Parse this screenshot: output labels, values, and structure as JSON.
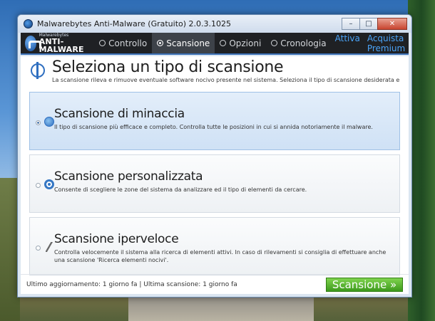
{
  "window": {
    "title": "Malwarebytes Anti-Malware (Gratuito) 2.0.3.1025",
    "minimize": "–",
    "maximize": "□",
    "close": "✕"
  },
  "brand": {
    "top": "Malwarebytes",
    "bottom": "ANTI-MALWARE"
  },
  "nav": {
    "tabs": [
      {
        "label": "Controllo",
        "icon": "clock-icon"
      },
      {
        "label": "Scansione",
        "icon": "scan-icon",
        "active": true
      },
      {
        "label": "Opzioni",
        "icon": "gear-icon"
      },
      {
        "label": "Cronologia",
        "icon": "history-icon"
      }
    ],
    "links": [
      "Attiva",
      "Acquista Premium"
    ]
  },
  "header": {
    "title": "Seleziona un tipo di scansione",
    "subtitle": "La scansione rileva e rimuove eventuale software nocivo presente nel sistema. Seleziona il tipo di scansione desiderata e"
  },
  "options": [
    {
      "title": "Scansione di minaccia",
      "desc": "Il tipo di scansione più efficace e completo. Controlla tutte le posizioni in cui si annida notoriamente il malware.",
      "selected": true
    },
    {
      "title": "Scansione personalizzata",
      "desc": "Consente di scegliere le zone del sistema da analizzare ed il tipo di elementi da cercare.",
      "selected": false
    },
    {
      "title": "Scansione iperveloce",
      "desc": "Controlla velocemente il sistema alla ricerca di elementi attivi. In caso di rilevamenti si consiglia di effettuare anche una scansione 'Ricerca elementi nocivi'.",
      "selected": false
    }
  ],
  "footer": {
    "status": "Ultimo aggiornamento: 1 giorno fa | Ultima scansione: 1 giorno fa",
    "scan_button": "Scansione »"
  }
}
